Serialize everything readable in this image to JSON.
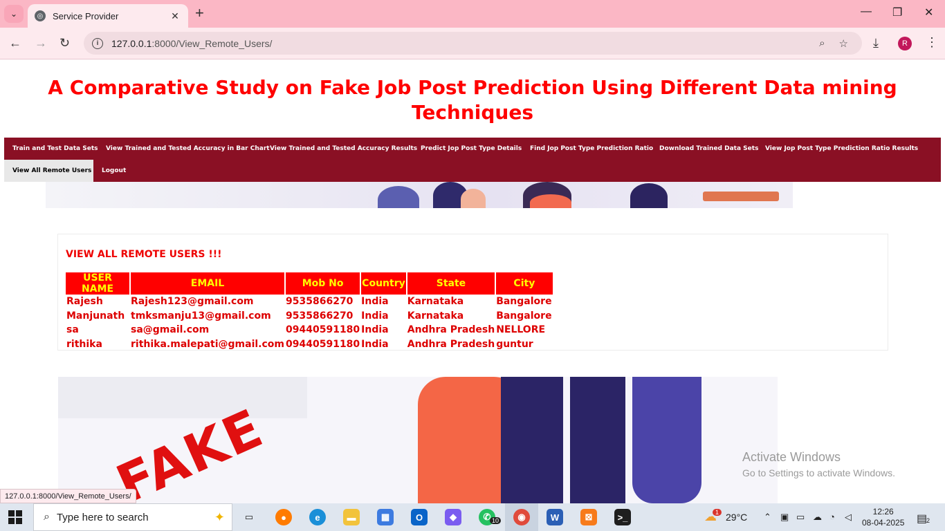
{
  "browser": {
    "tab_title": "Service Provider",
    "url_host": "127.0.0.1",
    "url_rest": ":8000/View_Remote_Users/",
    "profile_initial": "R",
    "status_url": "127.0.0.1:8000/View_Remote_Users/"
  },
  "site": {
    "title": "A Comparative Study on Fake Job Post Prediction Using Different Data mining Techniques",
    "nav": [
      {
        "label": "Train and Test Data Sets"
      },
      {
        "label": "View Trained and Tested Accuracy in Bar Chart"
      },
      {
        "label": "View Trained and Tested Accuracy Results"
      },
      {
        "label": "Predict Jop Post Type Details"
      },
      {
        "label": "Find Jop Post Type Prediction Ratio"
      },
      {
        "label": "Download Trained Data Sets"
      },
      {
        "label": "View Jop Post Type Prediction Ratio Results"
      },
      {
        "label": "View All Remote Users"
      },
      {
        "label": "Logout"
      }
    ],
    "active_nav": "View All Remote Users"
  },
  "content": {
    "heading": "VIEW ALL REMOTE USERS !!!",
    "columns": [
      "USER NAME",
      "EMAIL",
      "Mob No",
      "Country",
      "State",
      "City"
    ],
    "rows": [
      [
        "Rajesh",
        "Rajesh123@gmail.com",
        "9535866270",
        "India",
        "Karnataka",
        "Bangalore"
      ],
      [
        "Manjunath",
        "tmksmanju13@gmail.com",
        "9535866270",
        "India",
        "Karnataka",
        "Bangalore"
      ],
      [
        "sa",
        "sa@gmail.com",
        "09440591180",
        "India",
        "Andhra Pradesh",
        "NELLORE"
      ],
      [
        "rithika",
        "rithika.malepati@gmail.com",
        "09440591180",
        "India",
        "Andhra Pradesh",
        "guntur"
      ]
    ]
  },
  "hero": {
    "stamp_text": "FAKE"
  },
  "watermark": {
    "title": "Activate Windows",
    "subtitle": "Go to Settings to activate Windows."
  },
  "taskbar": {
    "search_placeholder": "Type here to search",
    "whatsapp_badge": "10",
    "weather_badge": "1",
    "temperature": "29°C",
    "time": "12:26",
    "date": "08-04-2025",
    "notification_count": "2"
  },
  "colors": {
    "title_red": "#ff0000",
    "navbar": "#8a1024",
    "table_header_bg": "#ff0000",
    "table_header_text": "#ffff00",
    "tab_strip": "#fbb7c5"
  }
}
